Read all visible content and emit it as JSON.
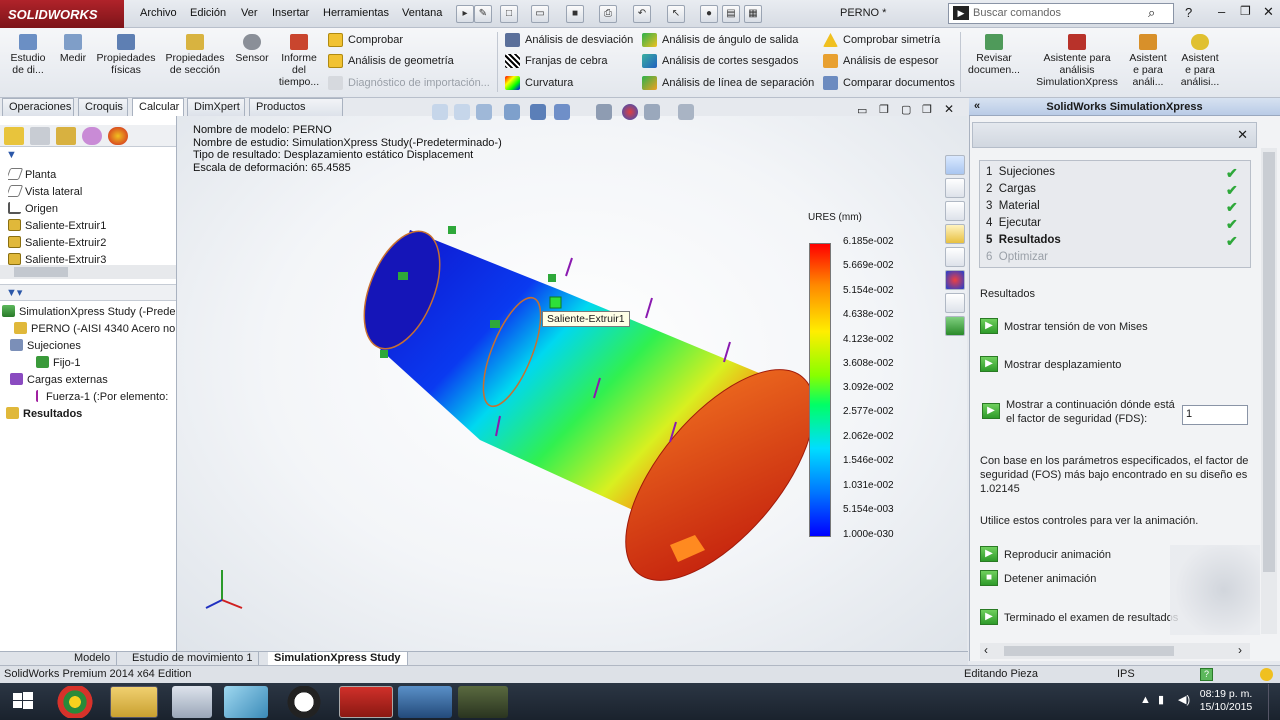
{
  "app": {
    "logo": "SOLIDWORKS",
    "doc_title": "PERNO *",
    "search_placeholder": "Buscar comandos"
  },
  "menu": [
    "Archivo",
    "Edición",
    "Ver",
    "Insertar",
    "Herramientas",
    "Ventana"
  ],
  "ribbon": {
    "big": [
      {
        "label": "Estudio\nde di...",
        "icon": "study-icon"
      },
      {
        "label": "Medir",
        "icon": "measure-icon"
      },
      {
        "label": "Propiedades\nfísicas",
        "icon": "mass-properties-icon"
      },
      {
        "label": "Propiedades\nde sección",
        "icon": "section-properties-icon"
      },
      {
        "label": "Sensor",
        "icon": "sensor-icon"
      },
      {
        "label": "Informe\ndel\ntiempo...",
        "icon": "report-icon"
      }
    ],
    "col1": [
      "Comprobar",
      "Análisis de geometría",
      "Diagnóstico de importación..."
    ],
    "col2": [
      "Análisis de desviación",
      "Franjas de cebra",
      "Curvatura"
    ],
    "col3": [
      "Análisis de ángulo de salida",
      "Análisis de cortes sesgados",
      "Análisis de línea de separación"
    ],
    "col4": [
      "Comprobar simetría",
      "Análisis de espesor",
      "Comparar documentos"
    ],
    "big2": [
      {
        "label": "Revisar\ndocumen..."
      },
      {
        "label": "Asistente para\nanálisis\nSimulationXpress"
      },
      {
        "label": "Asistent\ne para\nanáli..."
      },
      {
        "label": "Asistent\ne para\nanálisi..."
      }
    ]
  },
  "tabs": [
    "Operaciones",
    "Croquis",
    "Calcular",
    "DimXpert",
    "Productos Office"
  ],
  "tree_top": [
    "Planta",
    "Vista lateral",
    "Origen",
    "Saliente-Extruir1",
    "Saliente-Extruir2",
    "Saliente-Extruir3"
  ],
  "tree_bottom": [
    "SimulationXpress Study (-Prede",
    "PERNO (-AISI 4340 Acero no",
    "Sujeciones",
    "Fijo-1",
    "Cargas externas",
    "Fuerza-1 (:Por elemento:",
    "Resultados"
  ],
  "info": [
    "Nombre de modelo: PERNO",
    "Nombre de estudio: SimulationXpress Study(-Predeterminado-)",
    "Tipo de resultado: Desplazamiento estático Displacement",
    "Escala de deformación: 65.4585"
  ],
  "legend": {
    "title": "URES (mm)",
    "values": [
      "6.185e-002",
      "5.669e-002",
      "5.154e-002",
      "4.638e-002",
      "4.123e-002",
      "3.608e-002",
      "3.092e-002",
      "2.577e-002",
      "2.062e-002",
      "1.546e-002",
      "1.031e-002",
      "5.154e-003",
      "1.000e-030"
    ]
  },
  "tooltip": "Saliente-Extruir1",
  "sx": {
    "header": "SolidWorks SimulationXpress",
    "steps": [
      {
        "n": "1",
        "label": "Sujeciones",
        "done": true
      },
      {
        "n": "2",
        "label": "Cargas",
        "done": true
      },
      {
        "n": "3",
        "label": "Material",
        "done": true
      },
      {
        "n": "4",
        "label": "Ejecutar",
        "done": true
      },
      {
        "n": "5",
        "label": "Resultados",
        "done": true
      },
      {
        "n": "6",
        "label": "Optimizar",
        "done": false
      }
    ],
    "results_title": "Resultados",
    "btn_von_mises": "Mostrar tensión de von Mises",
    "btn_disp": "Mostrar desplazamiento",
    "fos_label": "Mostrar a continuación dónde está el factor de seguridad (FDS):",
    "fos_value": "1",
    "fos_text": "Con base en los parámetros especificados, el factor de seguridad (FOS) más bajo encontrado en su diseño es 1.02145",
    "anim_text": "Utilice estos controles para ver la animación.",
    "btn_play": "Reproducir animación",
    "btn_stop": "Detener animación",
    "btn_done": "Terminado el examen de resultados"
  },
  "bottom_tabs": [
    "Modelo",
    "Estudio de movimiento 1",
    "SimulationXpress Study"
  ],
  "status": {
    "edition": "SolidWorks Premium 2014 x64 Edition",
    "editing": "Editando Pieza",
    "units": "IPS"
  },
  "clock": {
    "time": "08:19 p. m.",
    "date": "15/10/2015"
  },
  "colors": {
    "accent_red": "#b0232a",
    "check_green": "#2ea83a",
    "header_blue": "#c6d5ec"
  }
}
